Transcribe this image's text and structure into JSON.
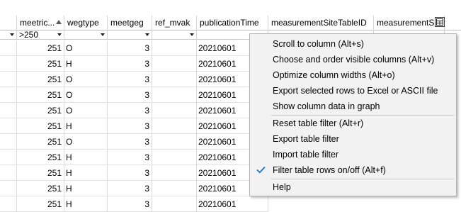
{
  "columns": [
    {
      "label": "meetric...",
      "filter": ">250",
      "sorted": "ascending"
    },
    {
      "label": "wegtype",
      "filter": ""
    },
    {
      "label": "meetgeg",
      "filter": ""
    },
    {
      "label": "ref_mvak",
      "filter": ""
    },
    {
      "label": "publicationTime",
      "filter": ""
    },
    {
      "label": "measurementSiteTableID",
      "filter": ""
    },
    {
      "label": "measurementS",
      "filter": ""
    }
  ],
  "rows": [
    {
      "meetric": "251",
      "wegtype": "O",
      "meetgeg": "3",
      "ref_mvak": "",
      "publicationTime": "20210601"
    },
    {
      "meetric": "251",
      "wegtype": "H",
      "meetgeg": "3",
      "ref_mvak": "",
      "publicationTime": "20210601"
    },
    {
      "meetric": "251",
      "wegtype": "O",
      "meetgeg": "3",
      "ref_mvak": "",
      "publicationTime": "20210601"
    },
    {
      "meetric": "251",
      "wegtype": "O",
      "meetgeg": "3",
      "ref_mvak": "",
      "publicationTime": "20210601"
    },
    {
      "meetric": "251",
      "wegtype": "O",
      "meetgeg": "3",
      "ref_mvak": "",
      "publicationTime": "20210601"
    },
    {
      "meetric": "251",
      "wegtype": "H",
      "meetgeg": "3",
      "ref_mvak": "",
      "publicationTime": "20210601"
    },
    {
      "meetric": "251",
      "wegtype": "O",
      "meetgeg": "3",
      "ref_mvak": "",
      "publicationTime": "20210601"
    },
    {
      "meetric": "251",
      "wegtype": "H",
      "meetgeg": "3",
      "ref_mvak": "",
      "publicationTime": "20210601"
    },
    {
      "meetric": "251",
      "wegtype": "H",
      "meetgeg": "3",
      "ref_mvak": "",
      "publicationTime": "20210601"
    },
    {
      "meetric": "251",
      "wegtype": "H",
      "meetgeg": "3",
      "ref_mvak": "",
      "publicationTime": "20210601"
    },
    {
      "meetric": "251",
      "wegtype": "H",
      "meetgeg": "3",
      "ref_mvak": "",
      "publicationTime": "20210601"
    }
  ],
  "context_menu": {
    "items": [
      {
        "label": "Scroll to column (Alt+s)",
        "checked": false
      },
      {
        "label": "Choose and order visible columns (Alt+v)",
        "checked": false
      },
      {
        "label": "Optimize column widths (Alt+o)",
        "checked": false
      },
      {
        "label": "Export selected rows to Excel or ASCII file",
        "checked": false
      },
      {
        "label": "Show column data in graph",
        "checked": false
      },
      {
        "label": "Reset table filter (Alt+r)",
        "checked": false
      },
      {
        "label": "Export table filter",
        "checked": false
      },
      {
        "label": "Import table filter",
        "checked": false
      },
      {
        "label": "Filter table rows on/off (Alt+f)",
        "checked": true
      },
      {
        "label": "Help",
        "checked": false
      }
    ]
  },
  "colors": {
    "menu_background": "#f2f2f2",
    "check_mark": "#1a73c8",
    "grid_line": "#dcdcdc"
  },
  "icons": {
    "column_menu": "column-menu-icon",
    "check": "check-icon"
  }
}
